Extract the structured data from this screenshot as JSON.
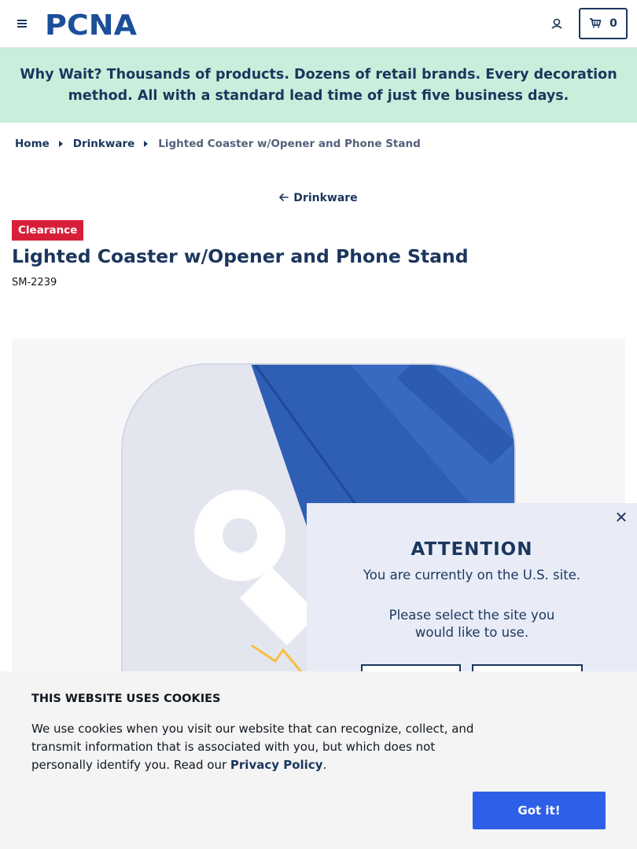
{
  "header": {
    "logo_text": "PCNA",
    "cart_count": "0",
    "icons": {
      "menu": "hamburger-menu-icon",
      "account": "user-icon",
      "cart": "cart-icon"
    }
  },
  "promo": {
    "lead": "Why Wait?",
    "text": " Thousands of products. Dozens of retail brands. Every decoration method. All with a standard lead time of just five business days."
  },
  "breadcrumb": {
    "items": [
      "Home",
      "Drinkware"
    ],
    "current": "Lighted Coaster w/Opener and Phone Stand"
  },
  "back_link": {
    "label": "Drinkware"
  },
  "product": {
    "badge": "Clearance",
    "title": "Lighted Coaster w/Opener and Phone Stand",
    "sku": "SM-2239"
  },
  "modal": {
    "title": "ATTENTION",
    "message": "You are currently on the U.S. site.",
    "prompt": "Please select the site you would like to use.",
    "close_icon": "close-icon"
  },
  "cookie": {
    "title": "THIS WEBSITE USES COOKIES",
    "text": "We use cookies when you visit our website that can recognize, collect, and transmit information that is associated with you, but which does not personally identify you. Read our ",
    "link": "Privacy Policy",
    "after_link": ".",
    "button": "Got it!"
  },
  "colors": {
    "brand_navy": "#1b365d",
    "promo_bg": "#c9eedb",
    "clearance_red": "#d81f3a",
    "product_blue": "#2f5fb5",
    "button_blue": "#2d5fe8",
    "modal_bg": "#e9ecf6"
  }
}
